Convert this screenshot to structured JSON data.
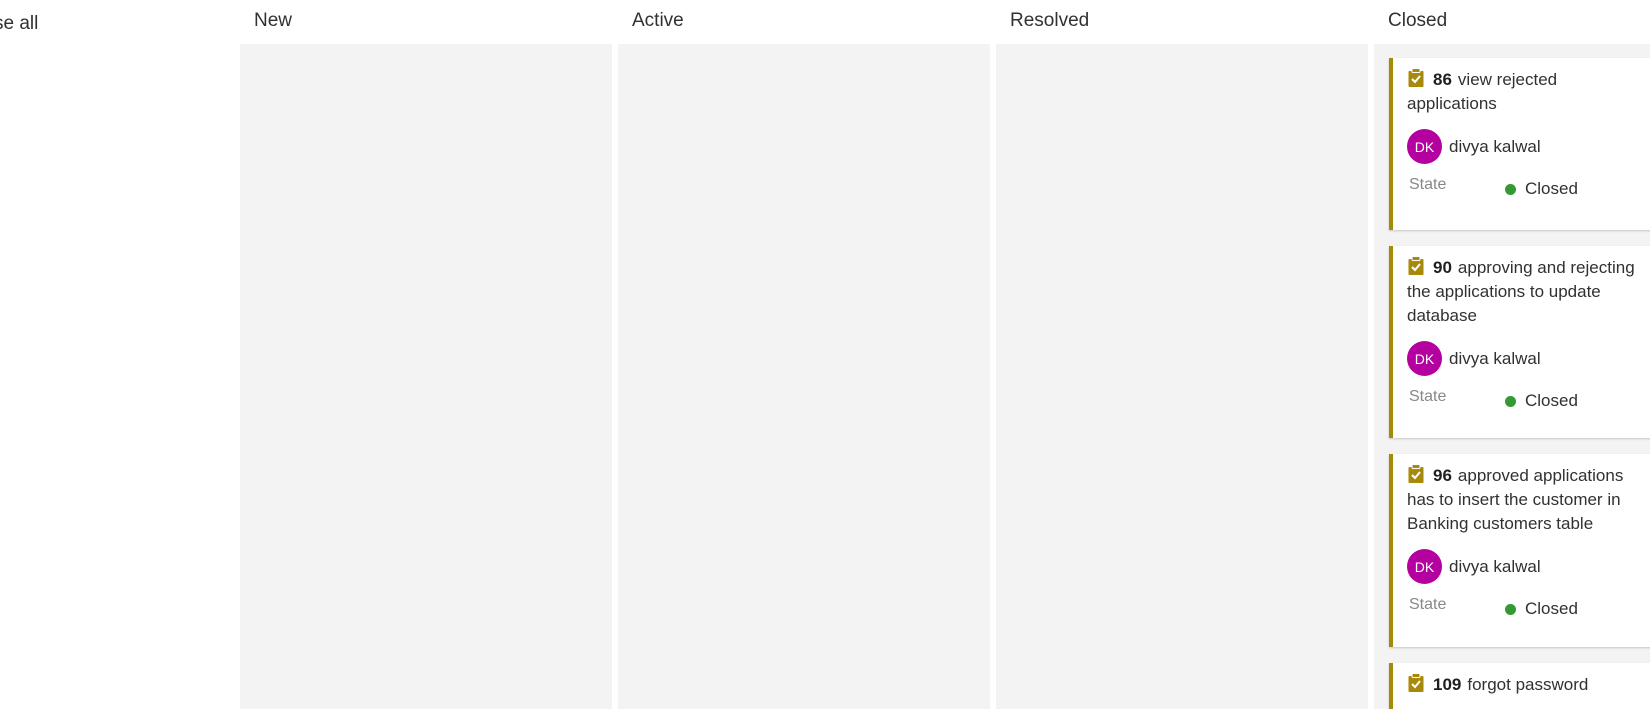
{
  "toolbar": {
    "collapse_all_label": "se all"
  },
  "columns": [
    {
      "title": "New"
    },
    {
      "title": "Active"
    },
    {
      "title": "Resolved"
    },
    {
      "title": "Closed"
    }
  ],
  "cards": [
    {
      "id": "86",
      "title": "view rejected applications",
      "assignee_initials": "DK",
      "assignee_name": "divya kalwal",
      "state_label": "State",
      "state_value": "Closed",
      "icon": "task-clipboard-icon"
    },
    {
      "id": "90",
      "title": "approving  and rejecting the applications to update database",
      "assignee_initials": "DK",
      "assignee_name": "divya kalwal",
      "state_label": "State",
      "state_value": "Closed",
      "icon": "task-clipboard-icon"
    },
    {
      "id": "96",
      "title": "approved applications has to insert the customer in Banking customers table",
      "assignee_initials": "DK",
      "assignee_name": "divya kalwal",
      "state_label": "State",
      "state_value": "Closed",
      "icon": "task-clipboard-icon"
    },
    {
      "id": "109",
      "title": "forgot password",
      "icon": "task-clipboard-icon"
    }
  ],
  "colors": {
    "card_accent": "#a88a0a",
    "avatar_bg": "#b4009e",
    "state_closed_dot": "#339933",
    "column_bg": "#f3f3f3"
  }
}
